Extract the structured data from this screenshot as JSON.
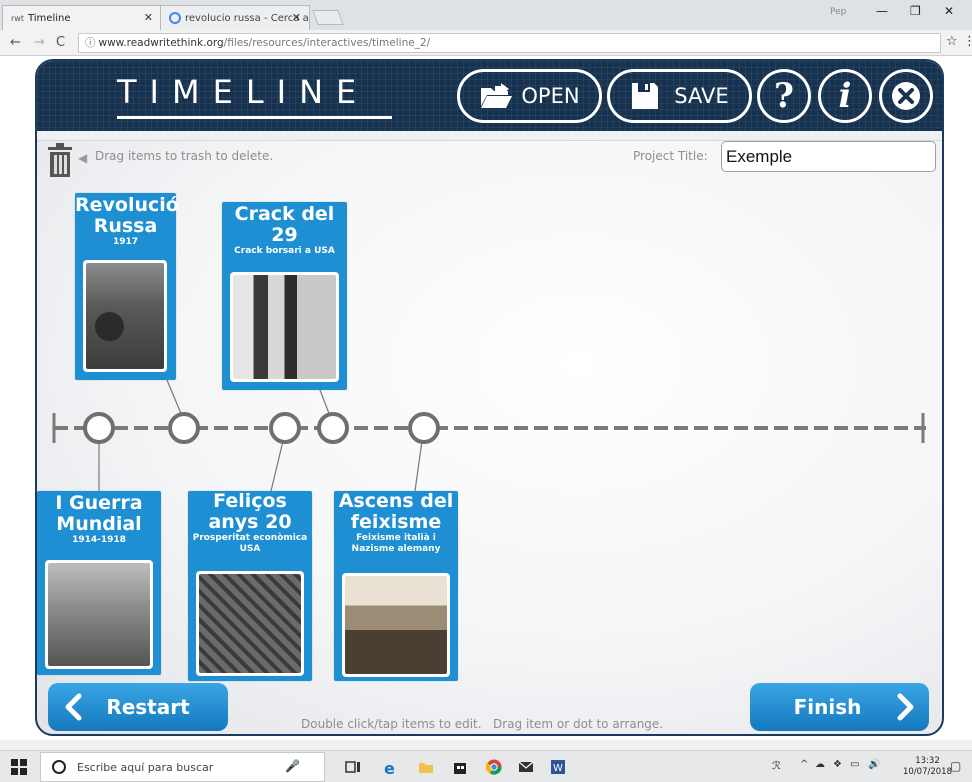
{
  "browser": {
    "tabs": [
      {
        "favicon": "rwt",
        "title": "Timeline"
      },
      {
        "favicon": "G",
        "title": "revolucio russa - Cerca a"
      }
    ],
    "profile": "Pep",
    "url_host": "www.readwritethink.org",
    "url_path": "/files/resources/interactives/timeline_2/"
  },
  "app": {
    "title": "TIMELINE",
    "buttons": {
      "open": "OPEN",
      "save": "SAVE",
      "help": "?",
      "info": "i"
    },
    "trash_hint": "Drag items to trash to delete.",
    "project_title_label": "Project Title:",
    "project_title_value": "Exemple",
    "restart_label": "Restart",
    "finish_label": "Finish",
    "bottom_hint": "Double click/tap items to edit.   Drag item or dot to arrange."
  },
  "cards": {
    "revolucio": {
      "title": "Revolució Russa",
      "sub": "1917"
    },
    "crack": {
      "title": "Crack del 29",
      "sub": "Crack borsari a USA"
    },
    "guerra": {
      "title": "I Guerra Mundial",
      "sub": "1914-1918"
    },
    "felicos": {
      "title": "Feliços anys 20",
      "sub": "Prosperitat econòmica USA"
    },
    "ascens": {
      "title": "Ascens del feixisme",
      "sub": "Feixisme italià i Nazisme alemany"
    }
  },
  "taskbar": {
    "search_placeholder": "Escribe aquí para buscar",
    "time": "13:32",
    "date": "10/07/2018"
  },
  "colors": {
    "header": "#16324f",
    "card": "#1f8fd4",
    "button": "#1a86cf",
    "timeline": "#7a7a7a"
  }
}
